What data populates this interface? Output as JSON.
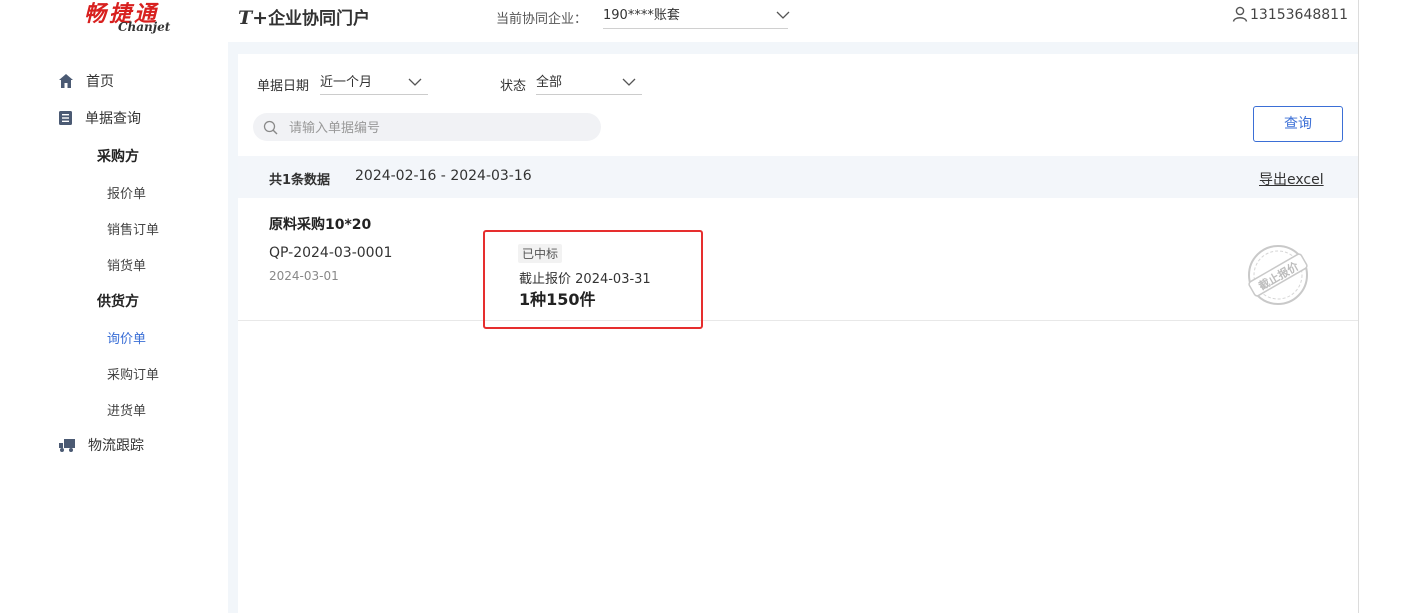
{
  "header": {
    "logo_cn": "畅捷通",
    "logo_en": "Chanjet",
    "portal_prefix": "T+",
    "portal_title": "企业协同门户",
    "company_label": "当前协同企业：",
    "company_value": "190****账套",
    "user_phone": "13153648811"
  },
  "sidebar": {
    "home": "首页",
    "doc_query": "单据查询",
    "buyer_group": "采购方",
    "buyer_items": [
      "报价单",
      "销售订单",
      "销货单"
    ],
    "supplier_group": "供货方",
    "supplier_items": [
      "询价单",
      "采购订单",
      "进货单"
    ],
    "logistics": "物流跟踪"
  },
  "filters": {
    "date_label": "单据日期",
    "date_value": "近一个月",
    "status_label": "状态",
    "status_value": "全部",
    "search_placeholder": "请输入单据编号",
    "query_button": "查询"
  },
  "summary": {
    "count_text": "共1条数据",
    "date_range": "2024-02-16 - 2024-03-16",
    "export_label": "导出excel"
  },
  "records": [
    {
      "title": "原料采购10*20",
      "code": "QP-2024-03-0001",
      "date": "2024-03-01",
      "status_badge": "已中标",
      "deadline_label": "截止报价",
      "deadline_date": "2024-03-31",
      "quantity": "1种150件",
      "stamp_text": "截止报价"
    }
  ],
  "colors": {
    "brand_red": "#d8201f",
    "accent_blue": "#3b6fd6",
    "highlight_red": "#e62e2e"
  }
}
